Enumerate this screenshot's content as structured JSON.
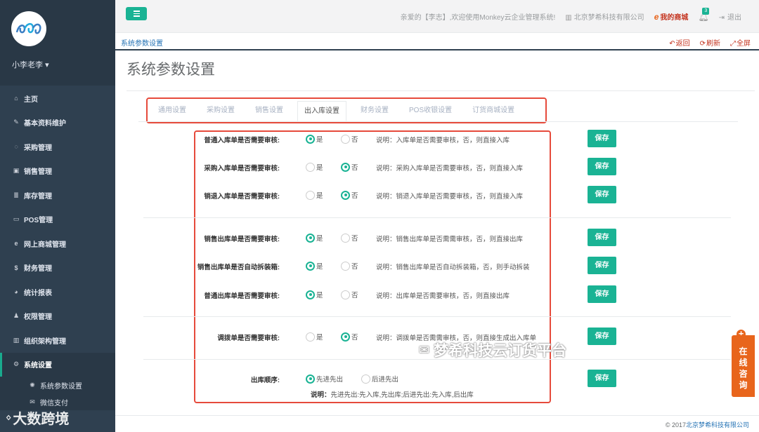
{
  "user": {
    "name": "小李老李"
  },
  "sidebar": {
    "items": [
      {
        "icon": "home-icon",
        "glyph": "⌂",
        "label": "主页"
      },
      {
        "icon": "pencil-icon",
        "glyph": "✎",
        "label": "基本资料维护"
      },
      {
        "icon": "shield-icon",
        "glyph": "◌",
        "label": "采购管理"
      },
      {
        "icon": "money-icon",
        "glyph": "▣",
        "label": "销售管理"
      },
      {
        "icon": "database-icon",
        "glyph": "≣",
        "label": "库存管理"
      },
      {
        "icon": "monitor-icon",
        "glyph": "▭",
        "label": "POS管理"
      },
      {
        "icon": "ie-icon",
        "glyph": "e",
        "label": "网上商城管理"
      },
      {
        "icon": "dollar-icon",
        "glyph": "$",
        "label": "财务管理"
      },
      {
        "icon": "piechart-icon",
        "glyph": "◕",
        "label": "统计报表"
      },
      {
        "icon": "user-icon",
        "glyph": "♟",
        "label": "权限管理"
      },
      {
        "icon": "building-icon",
        "glyph": "▥",
        "label": "组织架构管理"
      },
      {
        "icon": "gears-icon",
        "glyph": "⚙",
        "label": "系统设置"
      }
    ],
    "subitems": [
      {
        "icon": "gear-icon",
        "glyph": "✺",
        "label": "系统参数设置"
      },
      {
        "icon": "wechat-icon",
        "glyph": "✉",
        "label": "微信支付"
      }
    ],
    "watermark": "大数跨境"
  },
  "topbar": {
    "welcome": "亲爱的【李志】,欢迎使用Monkey云企业管理系统!",
    "company": "北京梦希科技有限公司",
    "shop": "我的商城",
    "notifications": "3",
    "logout": "退出"
  },
  "tabbar": {
    "title": "系统参数设置",
    "back": "返回",
    "refresh": "刷新",
    "fullscreen": "全屏"
  },
  "page": {
    "title": "系统参数设置",
    "tabs": [
      "通用设置",
      "采购设置",
      "销售设置",
      "出入库设置",
      "财务设置",
      "POS收银设置",
      "订货商城设置"
    ],
    "active_tab": "出入库设置",
    "yes": "是",
    "no": "否",
    "save": "保存",
    "rows": [
      {
        "label": "普通入库单是否需要审核:",
        "selected": "yes",
        "desc": "说明：入库单是否需要审核，否，则直接入库"
      },
      {
        "label": "采购入库单是否需要审核:",
        "selected": "no",
        "desc": "说明：采购入库单是否需要审核，否，则直接入库"
      },
      {
        "label": "销退入库单是否需要审核:",
        "selected": "no",
        "desc": "说明：销退入库单是否需要审核，否，则直接入库"
      },
      {
        "label": "销售出库单是否需要审核:",
        "selected": "yes",
        "desc": "说明：销售出库单是否需需审核，否，则直接出库"
      },
      {
        "label": "销售出库单是否自动拆装箱:",
        "selected": "yes",
        "desc": "说明：销售出库单是否自动拆装箱，否，则手动拆装"
      },
      {
        "label": "普通出库单是否需要审核:",
        "selected": "yes",
        "desc": "说明：出库单是否需要审核，否，则直接出库"
      },
      {
        "label": "调拨单是否需要审核:",
        "selected": "no",
        "desc": "说明：调拨单是否需需审核，否，则直接生成出入库单"
      }
    ],
    "order": {
      "label": "出库顺序:",
      "options": [
        "先进先出",
        "后进先出"
      ],
      "selected": "先进先出",
      "note_label": "说明：",
      "note": "先进先出:先入库,先出库;后进先出:先入库,后出库"
    }
  },
  "footer": {
    "prefix": "© 2017",
    "company": "北京梦希科技有限公司"
  },
  "overlays": {
    "wechat_watermark": "梦希科技云订货平台",
    "consult": [
      "在",
      "线",
      "咨",
      "询"
    ]
  },
  "colors": {
    "accent": "#1ab394",
    "sidebar": "#2f4050",
    "highlight": "#e64a3b",
    "consult": "#e8651c"
  }
}
